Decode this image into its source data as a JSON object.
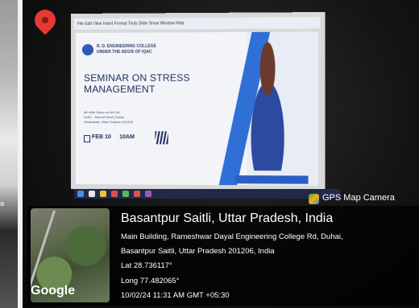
{
  "left_strip": {
    "label": "a"
  },
  "screen": {
    "menubar_text": "File  Edit  View  Insert  Format  Tools  Slide Show  Window  Help",
    "slide": {
      "org_line1": "R. D. ENGINEERING COLLEGE",
      "org_line2": "UNDER THE AEGIS OF IQAC",
      "title_line1": "SEMINAR ON STRESS",
      "title_line2": "MANAGEMENT",
      "address_line1": "6th Mile Stone on NH-58,",
      "address_line2": "Delhi – Meerut Road, Duhai,",
      "address_line3": "Ghaziabad, Uttar Pradesh 201206",
      "date": "FEB 10",
      "time": "10AM"
    }
  },
  "overlay": {
    "app_label": "GPS Map Camera",
    "place_title": "Basantpur Saitli, Uttar Pradesh, India",
    "address_line1": "Main Building, Rameshwar Dayal Engineering College Rd, Duhai,",
    "address_line2": "Basantpur Saitli, Uttar Pradesh 201206, India",
    "lat": "Lat 28.736117°",
    "long": "Long 77.482065°",
    "timestamp": "10/02/24 11:31 AM GMT +05:30",
    "map_brand": "Google"
  },
  "colors": {
    "accent": "#2f6fd6",
    "pin": "#e53935",
    "overlay_bg": "#000000"
  }
}
